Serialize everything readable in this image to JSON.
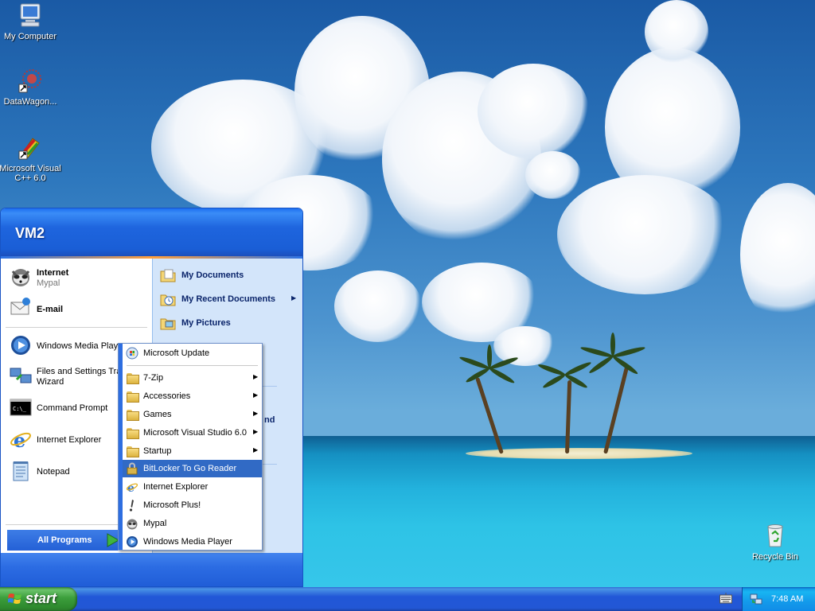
{
  "desktop": {
    "icons": [
      {
        "label": "My Computer",
        "icon": "my-computer-icon"
      },
      {
        "label": "DataWagon...",
        "icon": "datawagon-icon"
      },
      {
        "label": "Microsoft Visual C++ 6.0",
        "icon": "visual-cpp-icon"
      },
      {
        "label": "Recycle Bin",
        "icon": "recycle-bin-icon"
      }
    ]
  },
  "start_menu": {
    "user_name": "VM2",
    "pinned": [
      {
        "label": "Internet",
        "sublabel": "Mypal",
        "icon": "mypal-icon"
      },
      {
        "label": "E-mail",
        "icon": "email-icon"
      }
    ],
    "recent": [
      {
        "label": "Windows Media Playe",
        "icon": "media-player-icon"
      },
      {
        "label": "Files and Settings Tra",
        "label2": "Wizard",
        "icon": "transfer-wizard-icon"
      },
      {
        "label": "Command Prompt",
        "icon": "command-prompt-icon"
      },
      {
        "label": "Internet Explorer",
        "icon": "internet-explorer-icon"
      },
      {
        "label": "Notepad",
        "icon": "notepad-icon"
      }
    ],
    "right": [
      {
        "label": "My Documents",
        "icon": "my-documents-icon"
      },
      {
        "label": "My Recent Documents",
        "icon": "recent-documents-icon",
        "arrow": "▶"
      },
      {
        "label": "My Pictures",
        "icon": "my-pictures-icon"
      }
    ],
    "right_partial": "nd",
    "all_programs": "All Programs"
  },
  "programs_menu": {
    "items": [
      {
        "label": "Microsoft Update",
        "icon": "windows-update-icon"
      },
      {
        "label": "7-Zip",
        "icon": "folder-icon",
        "arrow": "▶"
      },
      {
        "label": "Accessories",
        "icon": "folder-icon",
        "arrow": "▶"
      },
      {
        "label": "Games",
        "icon": "folder-icon",
        "arrow": "▶"
      },
      {
        "label": "Microsoft Visual Studio 6.0",
        "icon": "folder-icon",
        "arrow": "▶"
      },
      {
        "label": "Startup",
        "icon": "folder-icon",
        "arrow": "▶"
      },
      {
        "label": "BitLocker To Go Reader",
        "icon": "bitlocker-icon"
      },
      {
        "label": "Internet Explorer",
        "icon": "internet-explorer-icon"
      },
      {
        "label": "Microsoft Plus!",
        "icon": "microsoft-plus-icon"
      },
      {
        "label": "Mypal",
        "icon": "mypal-icon"
      },
      {
        "label": "Windows Media Player",
        "icon": "media-player-icon"
      }
    ]
  },
  "taskbar": {
    "start_label": "start",
    "clock": "7:48 AM"
  },
  "colors": {
    "taskbar_blue": "#2257d5",
    "start_green": "#3c9e3c",
    "highlight_blue": "#316ac5"
  }
}
